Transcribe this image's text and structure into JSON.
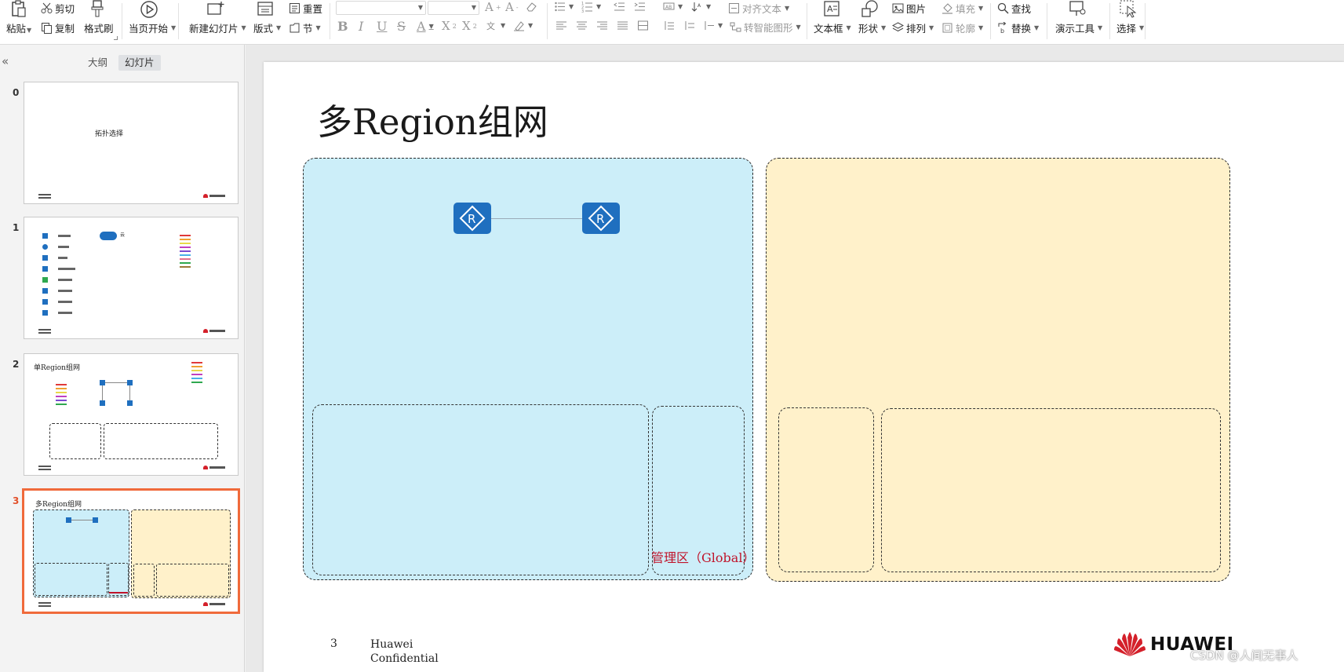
{
  "ribbon": {
    "paste": "粘贴",
    "cut": "剪切",
    "copy": "复制",
    "format_painter": "格式刷",
    "from_current": "当页开始",
    "new_slide": "新建幻灯片",
    "layout": "版式",
    "reset": "重置",
    "section": "节",
    "align_text": "对齐文本",
    "convert_smartart": "转智能图形",
    "textbox": "文本框",
    "shape": "形状",
    "picture": "图片",
    "arrange": "排列",
    "fill": "填充",
    "outline": "轮廓",
    "find": "查找",
    "replace": "替换",
    "presentation_tools": "演示工具",
    "select": "选择"
  },
  "panel": {
    "tab_outline": "大纲",
    "tab_slides": "幻灯片",
    "collapse_icon": "double-chevron-left"
  },
  "thumbnails": [
    {
      "number": "0",
      "title": "拓扑选择"
    },
    {
      "number": "1",
      "title": "云"
    },
    {
      "number": "2",
      "title": "单Region组网"
    },
    {
      "number": "3",
      "title": "多Region组网"
    }
  ],
  "slide": {
    "title": "多Region组网",
    "mgmt_label": "管理区（Global）",
    "page_number": "3",
    "footer_line1": "Huawei",
    "footer_line2": "Confidential",
    "logo_text": "HUAWEI",
    "router_symbol": "R"
  },
  "watermark": "CSDN @人间无事人",
  "colors": {
    "blue_region": "#cceef9",
    "yellow_region": "#fff1ca",
    "router": "#1f6fbf",
    "accent_active": "#f06a3b",
    "label_red": "#c0142b",
    "huawei_red": "#d4202a"
  }
}
